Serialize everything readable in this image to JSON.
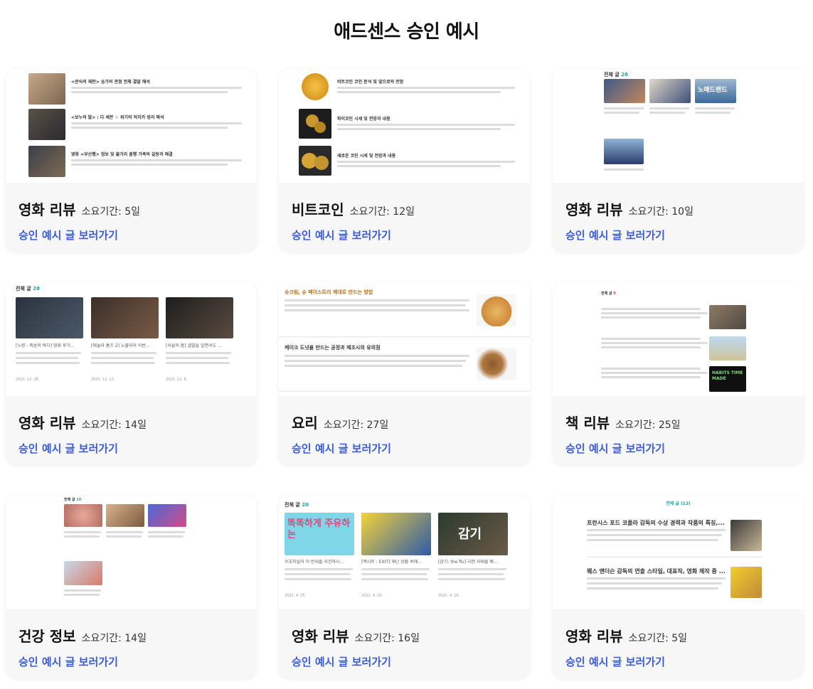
{
  "page_title": "애드센스 승인 예시",
  "link_label": "승인 예시 글 보러가기",
  "cards": [
    {
      "category": "영화 리뷰",
      "duration": "소요기간: 5일",
      "shot": {
        "posts": [
          "<관식의 재판> 승가의 관점 전체 결말 해석",
          "<보누의 말> : 다 세븐 ☆ 위기의 허치카 정리 해석",
          "영화 <부산행> 정보 및 줄거리 흥행 가족의 갈등과 해결"
        ]
      }
    },
    {
      "category": "비트코인",
      "duration": "소요기간: 12일",
      "shot": {
        "posts": [
          "비트코인 코인 분석 및 앞으로의 전망",
          "파이코인 시세 및 전망과 내용",
          "새로운 코인 시세 및 전망과 내용"
        ]
      }
    },
    {
      "category": "영화 리뷰",
      "duration": "소요기간: 10일",
      "shot": {
        "header": "전체 글",
        "count": "26",
        "thumb_text": "노매드랜드"
      }
    },
    {
      "category": "영화 리뷰",
      "duration": "소요기간: 14일",
      "shot": {
        "header": "전체 글",
        "count": "28",
        "posts": [
          "[노량 : 죽음의 바다] 영화 후기...",
          "[에놀라 홈즈 2] 노출되어 이번...",
          "[서울의 봄] 결말을 알면서도 ..."
        ],
        "dates": [
          "2023. 12. 28.",
          "2023. 12. 13.",
          "2023. 12. 8."
        ]
      }
    },
    {
      "category": "요리",
      "duration": "소요기간: 27일",
      "shot": {
        "posts": [
          "슈크림, 슈 페이스트리 제대로 만드는 방법",
          "케이크 도넛을 만드는 공정과 제조시의 유의점"
        ]
      }
    },
    {
      "category": "책 리뷰",
      "duration": "소요기간: 25일",
      "shot": {
        "header": "전체 글",
        "count": "9",
        "cover_text": "HABITS TIME MADE"
      }
    },
    {
      "category": "건강 정보",
      "duration": "소요기간: 14일",
      "shot": {
        "header": "전체 글",
        "count": "10"
      }
    },
    {
      "category": "영화 리뷰",
      "duration": "소요기간: 16일",
      "shot": {
        "header": "전체 글",
        "count": "20",
        "posts": [
          "수호하실이 이 반대를 사건하시...",
          "[엑시트 : EXIT] 재난 상황 속에...",
          "[감기: the flu] 극한 사태를 예..."
        ],
        "dates": [
          "2022. 4. 25.",
          "2022. 4. 20.",
          "2022. 4. 19."
        ],
        "thumb1": "똑똑하게 주유하는",
        "thumb3": "감기"
      }
    },
    {
      "category": "영화 리뷰",
      "duration": "소요기간: 5일",
      "shot": {
        "header": "전체 글 (13)",
        "posts": [
          "프란시스 포드 코폴라 감독의 수상 경력과 작품의 특징,...",
          "웨스 앤더슨 감독의 연출 스타일, 대표작, 영화 제작 중 ..."
        ]
      }
    }
  ],
  "colors": {
    "link": "#3b5bdb",
    "count_accent": "#19a6a0"
  }
}
